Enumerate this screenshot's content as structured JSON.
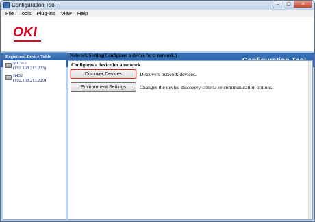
{
  "window": {
    "title": "Configuration Tool",
    "controls": {
      "minimize": "–",
      "maximize": "□",
      "close": "✕"
    }
  },
  "menu": [
    "File",
    "Tools",
    "Plug-ins",
    "View",
    "Help"
  ],
  "header": {
    "logo": "OKI",
    "band_title": "Configuration Tool",
    "brand_color": "#e8001c",
    "band_color": "#2b63a8"
  },
  "sidebar": {
    "heading": "Registered Device Table",
    "devices": [
      {
        "name": "MC562",
        "ip": "(192.168.213.233)",
        "icon": "printer-icon"
      },
      {
        "name": "B432",
        "ip": "(192.168.213.219)",
        "icon": "printer-icon"
      }
    ]
  },
  "main": {
    "title": "Network Setting(Configures a device for a network.)",
    "subtitle": "Configures a device for a network.",
    "actions": [
      {
        "label": "Discover Devices",
        "description": "Discovers network devices.",
        "focused": true
      },
      {
        "label": "Environment Settings",
        "description": "Changes the device discovery criteria or communication options.",
        "focused": false
      }
    ]
  }
}
